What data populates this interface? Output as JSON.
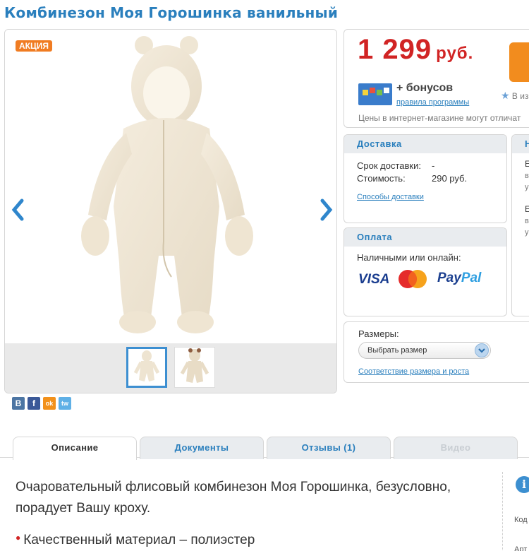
{
  "product": {
    "title": "Комбинезон Моя Горошинка ванильный",
    "badge": "АКЦИЯ"
  },
  "price": {
    "amount": "1 299",
    "currency": "руб.",
    "bonus_label": "+ бонусов",
    "bonus_rules_link": "правила программы",
    "wishlist_label": "В из",
    "note": "Цены в интернет-магазине могут отличат"
  },
  "delivery": {
    "heading": "Доставка",
    "term_label": "Срок доставки:",
    "term_value": "-",
    "cost_label": "Стоимость:",
    "cost_value": "290 руб.",
    "methods_link": "Способы доставки"
  },
  "side_panel": {
    "heading": "Н",
    "lines": [
      "Е",
      "в",
      "у",
      "Е",
      "в",
      "у"
    ]
  },
  "payment": {
    "heading": "Оплата",
    "methods_label": "Наличными или онлайн:",
    "logos": [
      "VISA",
      "MasterCard",
      "PayPal"
    ],
    "paypal_first": "Pay",
    "paypal_second": "Pal"
  },
  "sizes": {
    "label": "Размеры:",
    "select_value": "Выбрать размер",
    "chart_link": "Соответствие размера и роста"
  },
  "social": [
    "В",
    "f",
    "ok",
    "tw"
  ],
  "tabs": [
    {
      "label": "Описание",
      "state": "active"
    },
    {
      "label": "Документы",
      "state": "normal"
    },
    {
      "label": "Отзывы (1)",
      "state": "normal"
    },
    {
      "label": "Видео",
      "state": "disabled"
    }
  ],
  "description": {
    "text": "Очаровательный флисовый комбинезон Моя Горошинка, безусловно, порадует Вашу кроху.",
    "bullets": [
      "Качественный материал – полиэстер"
    ]
  },
  "right_info": {
    "icon": "i",
    "labels": [
      "Код",
      "Арт"
    ]
  },
  "colors": {
    "accent": "#2a7fbd",
    "price": "#d12424",
    "badge": "#f07c22",
    "buy_button": "#f28c1e"
  }
}
